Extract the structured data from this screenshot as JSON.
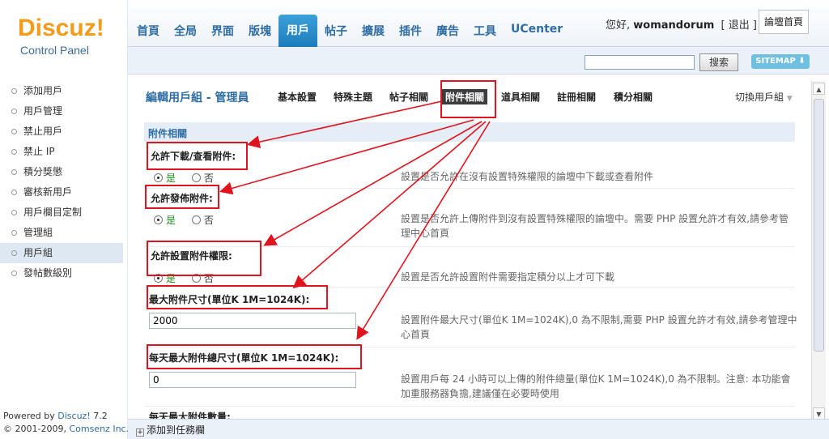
{
  "header": {
    "logo_text": "Discuz!",
    "logo_sub": "Control Panel",
    "nav_tabs": [
      {
        "label": "首頁"
      },
      {
        "label": "全局"
      },
      {
        "label": "界面"
      },
      {
        "label": "版塊"
      },
      {
        "label": "用戶",
        "active": true
      },
      {
        "label": "帖子"
      },
      {
        "label": "擴展"
      },
      {
        "label": "插件"
      },
      {
        "label": "廣告"
      },
      {
        "label": "工具"
      },
      {
        "label": "UCenter"
      }
    ],
    "greeting": "您好,",
    "username": "womandorum",
    "logout": "[ 退出 ]",
    "forum_home": "論壇首頁"
  },
  "subbar": {
    "search_value": "",
    "search_button": "搜索",
    "sitemap": "SITEMAP ⬇"
  },
  "sidebar": {
    "items": [
      {
        "label": "添加用戶"
      },
      {
        "label": "用戶管理"
      },
      {
        "label": "禁止用戶"
      },
      {
        "label": "禁止 IP"
      },
      {
        "label": "積分獎懲"
      },
      {
        "label": "審核新用戶"
      },
      {
        "label": "用戶欄目定制"
      },
      {
        "label": "管理組"
      },
      {
        "label": "用戶組",
        "active": true
      },
      {
        "label": "發帖數級別"
      }
    ],
    "powered_prefix": "Powered by",
    "powered_product": "Discuz!",
    "powered_version": "7.2",
    "copyright_prefix": "© 2001-2009,",
    "copyright_company": "Comsenz Inc."
  },
  "main": {
    "page_title": "編輯用戶組 - 管理員",
    "sub_tabs": [
      {
        "label": "基本設置"
      },
      {
        "label": "特殊主題"
      },
      {
        "label": "帖子相關"
      },
      {
        "label": "附件相關",
        "active": true
      },
      {
        "label": "道具相關"
      },
      {
        "label": "註冊相關"
      },
      {
        "label": "積分相關"
      }
    ],
    "switch_group": "切換用戶組",
    "section_title": "附件相關",
    "yes": "是",
    "no": "否",
    "settings": {
      "download": {
        "label": "允許下載/查看附件:",
        "value": "是",
        "desc": "設置是否允許在沒有設置特殊權限的論壇中下載或查看附件"
      },
      "post": {
        "label": "允許發佈附件:",
        "value": "是",
        "desc": "設置是否允許上傳附件到沒有設置特殊權限的論壇中。需要 PHP 設置允許才有效,請參考管理中心首頁"
      },
      "perm": {
        "label": "允許設置附件權限:",
        "value": "是",
        "desc": "設置是否允許設置附件需要指定積分以上才可下載"
      },
      "maxsize": {
        "label": "最大附件尺寸(單位K 1M=1024K):",
        "value": "2000",
        "desc": "設置附件最大尺寸(單位K 1M=1024K),0 為不限制,需要 PHP 設置允許才有效,請參考管理中心首頁"
      },
      "daysize": {
        "label": "每天最大附件總尺寸(單位K 1M=1024K):",
        "value": "0",
        "desc": "設置用戶每 24 小時可以上傳的附件總量(單位K 1M=1024K),0 為不限制。注意: 本功能會加重服務器負擔,建議僅在必要時使用"
      },
      "daycount": {
        "label": "每天最大附件數量:"
      }
    }
  },
  "footer": {
    "taskbar": "添加到任務欄"
  },
  "colors": {
    "accent": "#2f6da3",
    "annotation": "#e0141e",
    "logo": "#f39b1a"
  }
}
